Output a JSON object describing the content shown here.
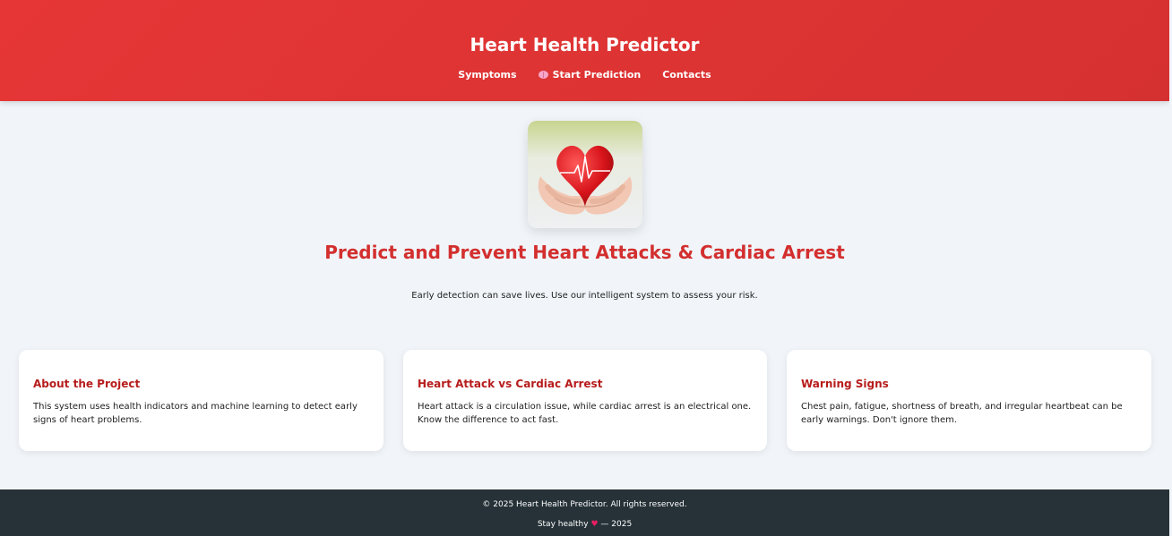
{
  "header": {
    "title": "Heart Health Predictor",
    "nav": [
      {
        "label": "Symptoms",
        "icon": ""
      },
      {
        "label": "Start Prediction",
        "icon": "brain-icon"
      },
      {
        "label": "Contacts",
        "icon": ""
      }
    ],
    "bg_color": "#e03434"
  },
  "hero": {
    "image": "hands-holding-heart-with-ecg-line",
    "title": "Predict and Prevent Heart Attacks & Cardiac Arrest",
    "subtitle": "Early detection can save lives. Use our intelligent system to assess your risk."
  },
  "cards": [
    {
      "title": "About the Project",
      "text": "This system uses health indicators and machine learning to detect early signs of heart problems."
    },
    {
      "title": "Heart Attack vs Cardiac Arrest",
      "text": "Heart attack is a circulation issue, while cardiac arrest is an electrical one. Know the difference to act fast."
    },
    {
      "title": "Warning Signs",
      "text": "Chest pain, fatigue, shortness of breath, and irregular heartbeat can be early warnings. Don't ignore them."
    }
  ],
  "footer": {
    "copyright": "© 2025 Heart Health Predictor. All rights reserved.",
    "tagline_prefix": "Stay healthy",
    "tagline_icon": "heart-icon",
    "tagline_suffix": "— 2025",
    "bg_color": "#263238"
  },
  "colors": {
    "accent": "#d32f2f",
    "card_title": "#b71c1c",
    "page_bg": "#f1f5f9"
  }
}
